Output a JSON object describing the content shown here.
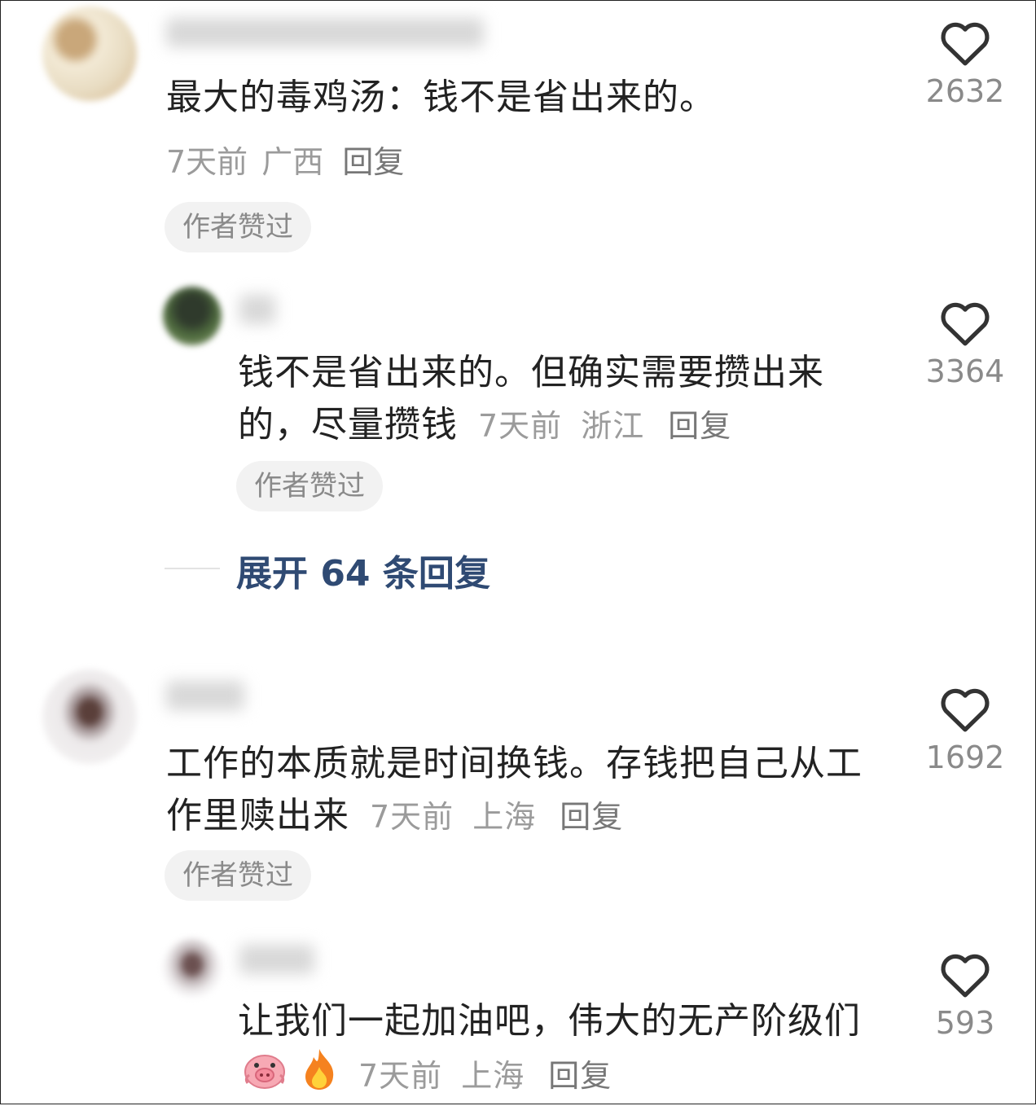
{
  "comments": [
    {
      "content": "最大的毒鸡汤：钱不是省出来的。",
      "time": "7天前",
      "location": "广西",
      "reply_label": "回复",
      "badge": "作者赞过",
      "likes": "2632",
      "replies": [
        {
          "content": "钱不是省出来的。但确实需要攒出来的，尽量攒钱",
          "time": "7天前",
          "location": "浙江",
          "reply_label": "回复",
          "badge": "作者赞过",
          "likes": "3364"
        }
      ],
      "expand_label": "展开 64 条回复"
    },
    {
      "content": "工作的本质就是时间换钱。存钱把自己从工作里赎出来",
      "time": "7天前",
      "location": "上海",
      "reply_label": "回复",
      "badge": "作者赞过",
      "likes": "1692",
      "replies": [
        {
          "content": "让我们一起加油吧，伟大的无产阶级们",
          "emojis": [
            "pig-face-emoji",
            "fire-emoji"
          ],
          "time": "7天前",
          "location": "上海",
          "reply_label": "回复",
          "likes": "593"
        }
      ]
    }
  ],
  "icons": {
    "like": "heart-outline-icon"
  },
  "colors": {
    "expand_link": "#2f4a73",
    "meta": "#9b9b9b",
    "badge_bg": "#f2f2f2"
  }
}
